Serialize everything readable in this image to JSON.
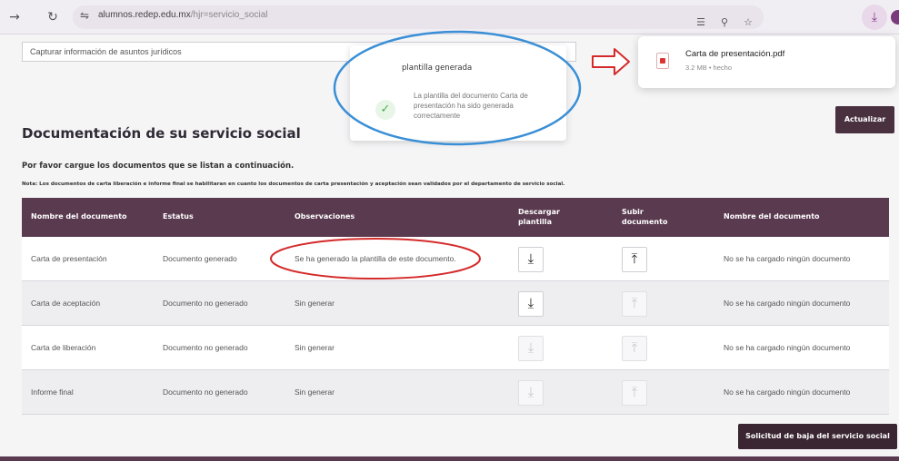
{
  "browser": {
    "url_host": "alumnos.redep.edu.mx",
    "url_path": "/hjr=servicio_social",
    "icons": [
      "back-icon",
      "reload-icon",
      "tune-icon",
      "translate-icon",
      "zoom-icon",
      "star-icon",
      "download-icon",
      "profile-icon"
    ]
  },
  "page": {
    "capture_placeholder": "Capturar información de asuntos jurídicos",
    "update_label": "Actualizar",
    "section_title": "Documentación de su servicio social",
    "intro": "Por favor cargue los documentos que se listan a continuación.",
    "note": "Nota: Los documentos de carta liberación e informe final se habilitaran en cuanto los documentos de carta presentación y aceptación sean validados por el departamento de servicio social.",
    "baja_label": "Solicitud de baja del servicio social"
  },
  "table": {
    "headers": [
      "Nombre del documento",
      "Estatus",
      "Observaciones",
      "Descargar plantilla",
      "Subir documento",
      "Nombre del documento"
    ],
    "rows": [
      {
        "name": "Carta de presentación",
        "status": "Documento generado",
        "observations": "Se ha generado la plantilla de este documento.",
        "download_enabled": true,
        "upload_enabled": true,
        "file": "No se ha cargado ningún documento"
      },
      {
        "name": "Carta de aceptación",
        "status": "Documento no generado",
        "observations": "Sin generar",
        "download_enabled": true,
        "upload_enabled": false,
        "file": "No se ha cargado ningún documento"
      },
      {
        "name": "Carta de liberación",
        "status": "Documento no generado",
        "observations": "Sin generar",
        "download_enabled": false,
        "upload_enabled": false,
        "file": "No se ha cargado ningún documento"
      },
      {
        "name": "Informe final",
        "status": "Documento no generado",
        "observations": "Sin generar",
        "download_enabled": false,
        "upload_enabled": false,
        "file": "No se ha cargado ningún documento"
      }
    ]
  },
  "toast": {
    "title": "plantilla generada",
    "message": "La plantilla del documento Carta de presentación ha sido generada correctamente",
    "icon": "check-icon"
  },
  "download_popup": {
    "filename": "Carta de presentación.pdf",
    "meta": "3.2 MB • hecho",
    "icon": "pdf-file-icon"
  },
  "colors": {
    "header": "#5a3a4f",
    "button_dark": "#3a2632",
    "annotation_blue": "#3a8fd6",
    "annotation_red": "#d42a2a"
  }
}
